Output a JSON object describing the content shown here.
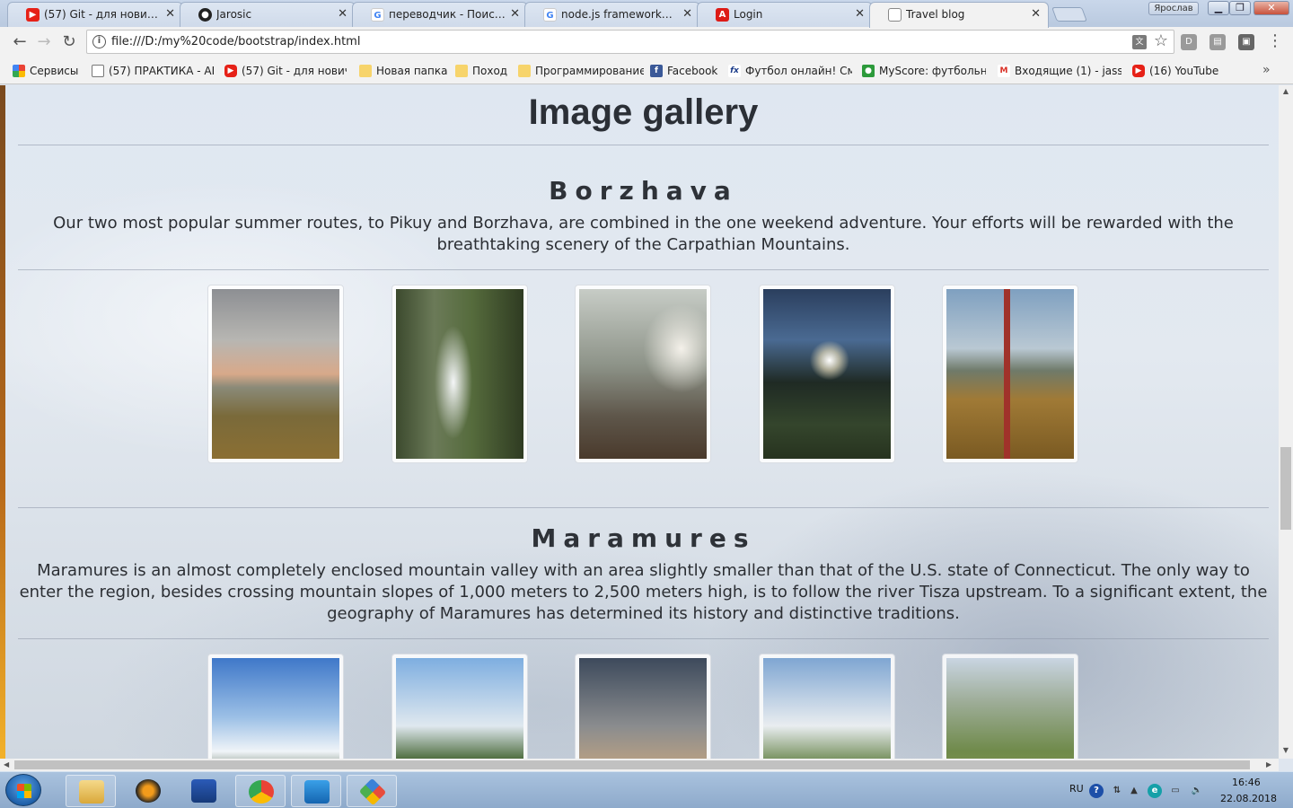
{
  "browser": {
    "tabs": [
      {
        "label": "(57) Git - для новичков -",
        "icon": "youtube-icon",
        "color": "#e62117"
      },
      {
        "label": "Jarosic",
        "icon": "github-icon",
        "color": "#222222"
      },
      {
        "label": "переводчик - Поиск в G",
        "icon": "google-icon",
        "color": "#4285f4"
      },
      {
        "label": "node.js frameworks - Пои",
        "icon": "google-icon",
        "color": "#4285f4"
      },
      {
        "label": "Login",
        "icon": "angular-icon",
        "color": "#dd1b16"
      },
      {
        "label": "Travel blog",
        "icon": "page-icon",
        "color": "#888888"
      }
    ],
    "user_name": "Ярослав",
    "url": "file:///D:/my%20code/bootstrap/index.html",
    "bookmarks": [
      {
        "label": "Сервисы",
        "icon": "apps-grid-icon"
      },
      {
        "label": "(57) ПРАКТИКА - АН",
        "icon": "page-icon"
      },
      {
        "label": "(57) Git - для новичк",
        "icon": "youtube-icon"
      },
      {
        "label": "Новая папка",
        "icon": "folder-icon"
      },
      {
        "label": "Поход",
        "icon": "folder-icon"
      },
      {
        "label": "Программирование",
        "icon": "folder-icon"
      },
      {
        "label": "Facebook",
        "icon": "facebook-icon"
      },
      {
        "label": "Футбол онлайн! Смс",
        "icon": "fx-icon"
      },
      {
        "label": "MyScore: футбольны",
        "icon": "myscore-icon"
      },
      {
        "label": "Входящие (1) - jasso",
        "icon": "gmail-icon"
      },
      {
        "label": "(16) YouTube",
        "icon": "youtube-icon"
      }
    ],
    "more_bookmarks": "»"
  },
  "page": {
    "title": "Image gallery",
    "sections": [
      {
        "title": "Borzhava",
        "description": "Our two most popular summer routes, to Pikuy and Borzhava, are combined in the one weekend adventure. Your efforts will be rewarded with the breathtaking scenery of the Carpathian Mountains.",
        "photos": [
          "cloudy-valley-photo",
          "waterfall-photo",
          "misty-forest-photo",
          "tent-sunset-photo",
          "signpost-meadow-photo"
        ]
      },
      {
        "title": "Maramures",
        "description": "Maramures is an almost completely enclosed mountain valley with an area slightly smaller than that of the U.S. state of Connecticut. The only way to enter the region, besides crossing mountain slopes of 1,000 meters to 2,500 meters high, is to follow the river Tisza upstream. To a significant extent, the geography of Maramures has determined its history and distinctive traditions.",
        "photos": [
          "green-peak-photo",
          "forest-trail-photo",
          "sunrise-silhouette-photo",
          "ridge-hills-photo",
          "mountain-path-photo"
        ]
      }
    ]
  },
  "taskbar": {
    "apps": [
      "explorer-icon",
      "aimp-icon",
      "save-disk-icon",
      "chrome-icon",
      "vscode-icon",
      "git-icon"
    ],
    "language": "RU",
    "time": "16:46",
    "date": "22.08.2018"
  }
}
